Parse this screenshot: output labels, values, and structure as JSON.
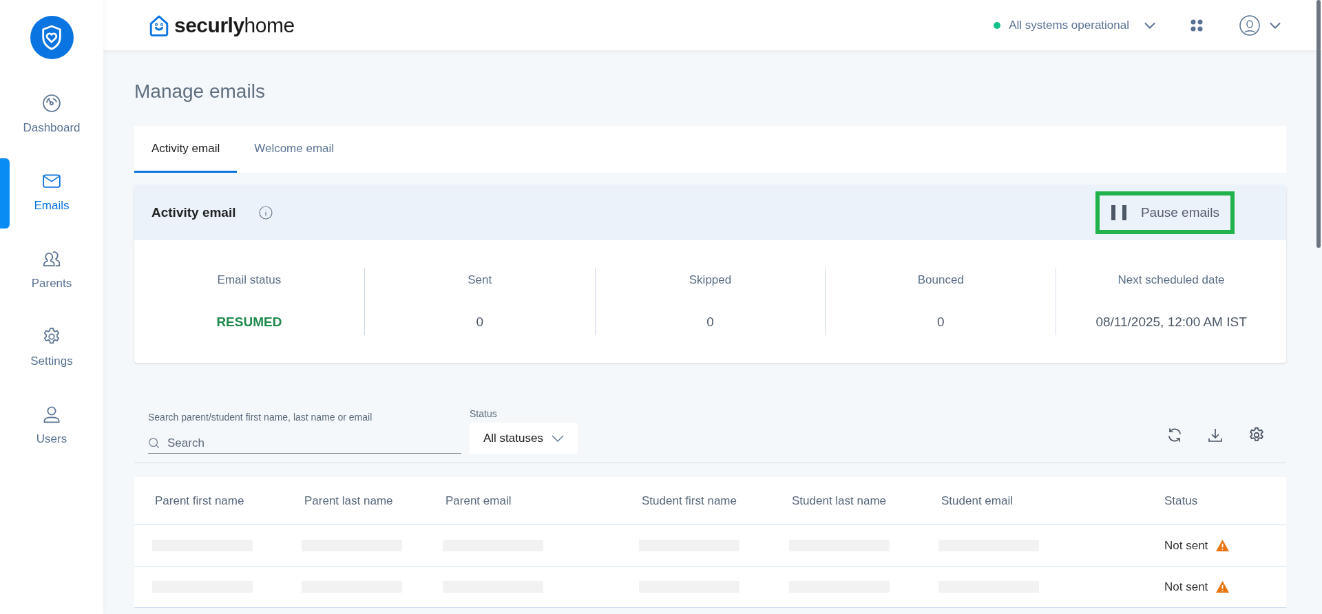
{
  "sidebar": {
    "items": [
      {
        "label": "Dashboard",
        "selected": false
      },
      {
        "label": "Emails",
        "selected": true
      },
      {
        "label": "Parents",
        "selected": false
      },
      {
        "label": "Settings",
        "selected": false
      },
      {
        "label": "Users",
        "selected": false
      }
    ]
  },
  "header": {
    "logo": {
      "bold": "securly",
      "light": "home"
    },
    "system_status": {
      "label": "All systems operational",
      "color": "#10c08a"
    }
  },
  "page_title": "Manage emails",
  "tabs": [
    {
      "label": "Activity email",
      "selected": true
    },
    {
      "label": "Welcome email",
      "selected": false
    }
  ],
  "activity_card": {
    "title": "Activity email",
    "action": "Pause emails",
    "stats": [
      {
        "label": "Email status",
        "value": "RESUMED",
        "kind": "status"
      },
      {
        "label": "Sent",
        "value": "0",
        "kind": "number"
      },
      {
        "label": "Skipped",
        "value": "0",
        "kind": "number"
      },
      {
        "label": "Bounced",
        "value": "0",
        "kind": "number"
      },
      {
        "label": "Next scheduled date",
        "value": "08/11/2025, 12:00 AM IST",
        "kind": "number"
      }
    ]
  },
  "filters": {
    "search_label": "Search parent/student first name, last name or email",
    "search_placeholder": "Search",
    "status_label": "Status",
    "status_value": "All statuses"
  },
  "table": {
    "columns": [
      "Parent first name",
      "Parent last name",
      "Parent email",
      "Student first name",
      "Student last name",
      "Student email",
      "Status"
    ],
    "rows": [
      {
        "status": "Not sent",
        "warning": true
      },
      {
        "status": "Not sent",
        "warning": true
      }
    ]
  }
}
